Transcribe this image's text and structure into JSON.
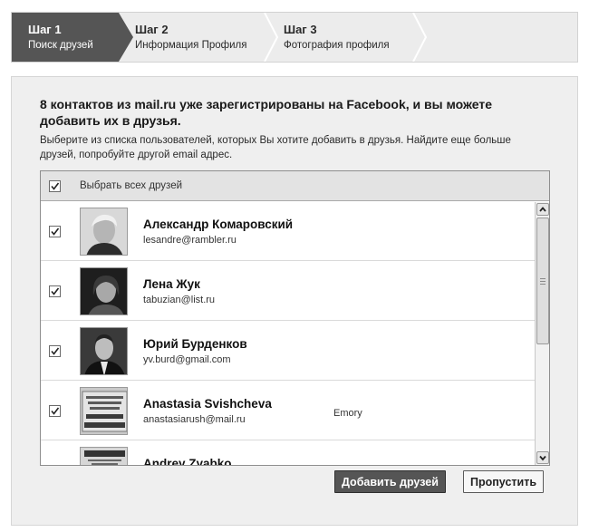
{
  "steps": [
    {
      "title": "Шаг 1",
      "subtitle": "Поиск друзей",
      "active": true
    },
    {
      "title": "Шаг 2",
      "subtitle": "Информация Профиля",
      "active": false
    },
    {
      "title": "Шаг 3",
      "subtitle": "Фотография профиля",
      "active": false
    }
  ],
  "main": {
    "heading": "8 контактов из mail.ru уже зарегистрированы на Facebook, и вы можете добавить их в друзья.",
    "description": "Выберите из списка пользователей, которых Вы хотите добавить в друзья. Найдите еще больше друзей, попробуйте другой email адрес."
  },
  "list": {
    "select_all_label": "Выбрать всех друзей",
    "select_all_checked": true,
    "contacts": [
      {
        "name": "Александр Комаровский",
        "email": "lesandre@rambler.ru",
        "extra": "",
        "checked": true,
        "photo": "portrait-photo-light"
      },
      {
        "name": "Лена Жук",
        "email": "tabuzian@list.ru",
        "extra": "",
        "checked": true,
        "photo": "portrait-photo-dark"
      },
      {
        "name": "Юрий Бурденков",
        "email": "yv.burd@gmail.com",
        "extra": "",
        "checked": true,
        "photo": "portrait-photo-suit"
      },
      {
        "name": "Anastasia Svishcheva",
        "email": "anastasiarush@mail.ru",
        "extra": "Emory",
        "checked": true,
        "photo": "sign-photo"
      },
      {
        "name": "Andrey Zyabko",
        "email": "",
        "extra": "",
        "checked": true,
        "photo": "wanted-poster-photo"
      }
    ]
  },
  "actions": {
    "add_friends_label": "Добавить друзей",
    "skip_label": "Пропустить"
  },
  "colors": {
    "active_step": "#555555",
    "primary_button": "#555555",
    "panel_background": "#efefef"
  }
}
